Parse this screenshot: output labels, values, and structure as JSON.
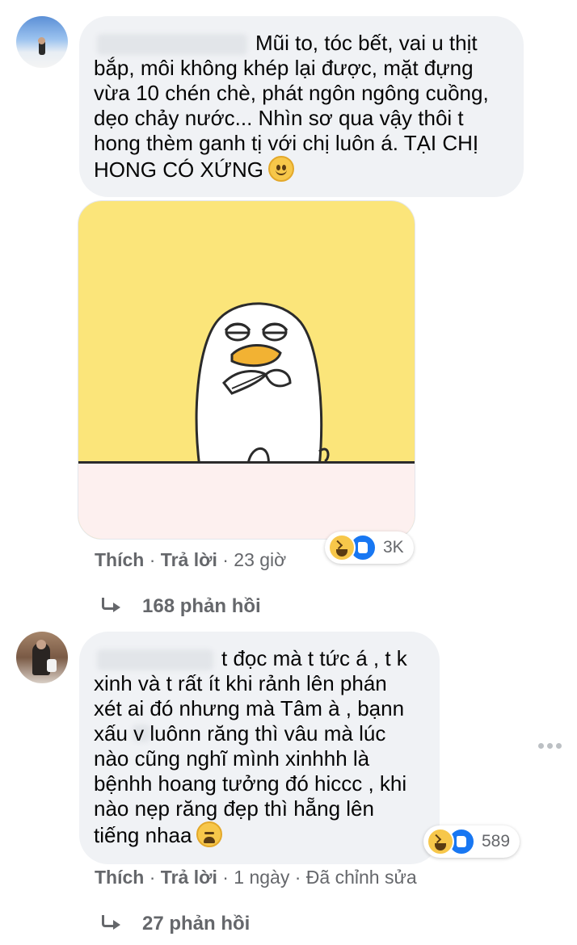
{
  "comments": [
    {
      "text": "Mũi to, tóc bết, vai u thịt\nbắp, môi không khép lại được, mặt đựng\nvừa 10 chén chè, phát ngôn ngông cuồng,\ndẹo chảy nước... Nhìn sơ qua vậy thôi t\nhong thèm ganh tị với chị luôn á. TẠI CHỊ\nHONG CÓ XỨNG",
      "trailing_emoji": "slightly-smiling-face-emoji",
      "reactions": {
        "icons": [
          "haha-icon",
          "like-icon"
        ],
        "count": "3K"
      },
      "actions": {
        "like": "Thích",
        "reply": "Trả lời",
        "time": "· 23 giờ"
      },
      "replies_label": "168 phản hồi"
    },
    {
      "text": "t đọc mà t tức á , t k\nxinh và t rất ít khi rảnh lên phán\nxét ai đó nhưng mà Tâm à , bạnn\nxấu v   luônn răng thì vâu mà lúc\nnào cũng nghĩ mình xinhhh là\nbệnhh hoang tưởng đó hiccc , khi\nnào nẹp răng đẹp thì hẵng lên\ntiếng nhaa",
      "trailing_emoji": "tired-face-emoji",
      "reactions": {
        "icons": [
          "haha-icon",
          "like-icon"
        ],
        "count": "589"
      },
      "actions": {
        "like": "Thích",
        "reply": "Trả lời",
        "time": "· 1 ngày · Đã chỉnh sửa"
      },
      "replies_label": "27 phản hồi"
    }
  ],
  "colors": {
    "bubble": "#f0f2f5",
    "secondary_text": "#65676b",
    "like_blue": "#1877f2",
    "sticker_yellow": "#fbe57a"
  }
}
